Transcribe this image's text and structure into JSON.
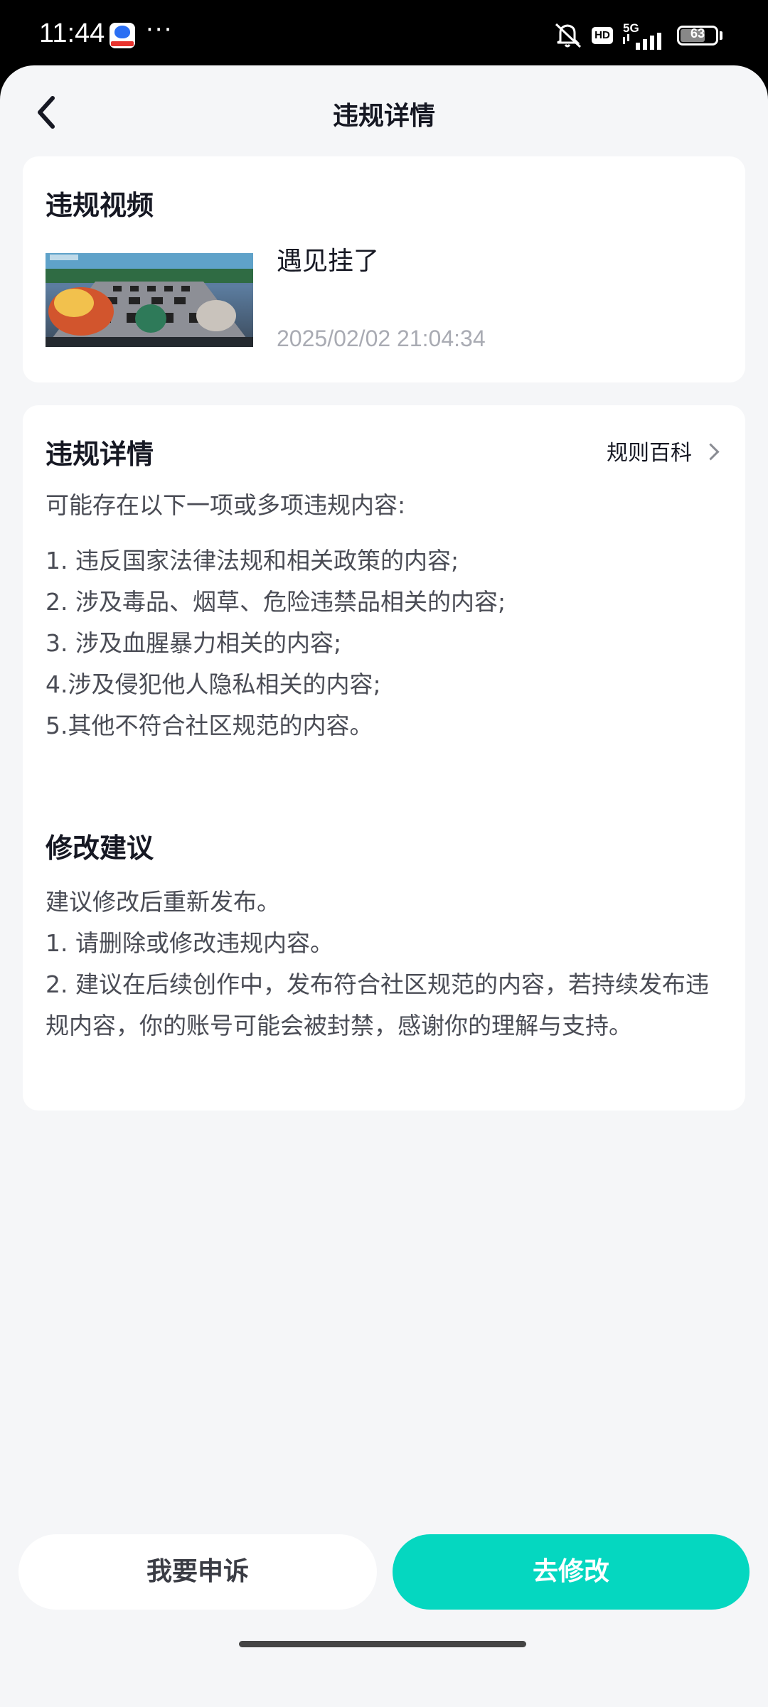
{
  "status_bar": {
    "time": "11:44",
    "dots": "···",
    "network": "5G",
    "hd": "HD",
    "battery": "63",
    "icons": [
      "baidu-app-icon",
      "mute-icon",
      "hd-icon",
      "5g-signal-icon",
      "battery-icon"
    ]
  },
  "nav": {
    "title": "违规详情",
    "back_icon": "chevron-left-icon"
  },
  "video_card": {
    "title": "违规视频",
    "video_title": "遇见挂了",
    "timestamp": "2025/02/02 21:04:34"
  },
  "details_card": {
    "title": "违规详情",
    "rules_link": "规则百科",
    "intro": "可能存在以下一项或多项违规内容:",
    "items": [
      "1. 违反国家法律法规和相关政策的内容;",
      "2. 涉及毒品、烟草、危险违禁品相关的内容;",
      "3. 涉及血腥暴力相关的内容;",
      "4.涉及侵犯他人隐私相关的内容;",
      "5.其他不符合社区规范的内容。"
    ]
  },
  "suggest_card": {
    "title": "修改建议",
    "lines": [
      "建议修改后重新发布。",
      "1. 请删除或修改违规内容。",
      "2. 建议在后续创作中，发布符合社区规范的内容，若持续发布违规内容，你的账号可能会被封禁，感谢你的理解与支持。"
    ]
  },
  "actions": {
    "appeal": "我要申诉",
    "edit": "去修改"
  },
  "colors": {
    "accent": "#05d7c0",
    "background": "#f5f6f8"
  }
}
